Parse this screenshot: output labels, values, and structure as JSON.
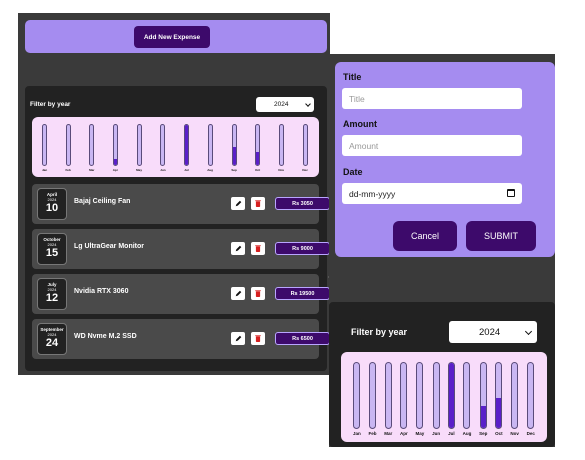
{
  "left_view": {
    "add_button": {
      "label": "Add New Expense"
    },
    "filter": {
      "label": "Filter by year",
      "selected_year": "2024"
    },
    "chart_data": {
      "type": "bar",
      "categories": [
        "Jan",
        "Feb",
        "Mar",
        "Apr",
        "May",
        "Jun",
        "Jul",
        "Aug",
        "Sep",
        "Oct",
        "Nov",
        "Dec"
      ],
      "values": [
        0,
        0,
        0,
        3050,
        0,
        0,
        19500,
        0,
        9000,
        6500,
        0,
        0
      ],
      "ylim": [
        0,
        19500
      ]
    },
    "expenses": [
      {
        "month": "April",
        "year": "2024",
        "day": "10",
        "title": "Bajaj Ceiling Fan",
        "amount": "Rs 3050"
      },
      {
        "month": "October",
        "year": "2024",
        "day": "15",
        "title": "Lg UltraGear Monitor",
        "amount": "Rs 9000"
      },
      {
        "month": "July",
        "year": "2024",
        "day": "12",
        "title": "Nvidia RTX 3060",
        "amount": "Rs 19500"
      },
      {
        "month": "September",
        "year": "2024",
        "day": "24",
        "title": "WD Nvme M.2 SSD",
        "amount": "Rs 6500"
      }
    ]
  },
  "right_view": {
    "form": {
      "title_label": "Title",
      "title_placeholder": "Title",
      "amount_label": "Amount",
      "amount_placeholder": "Amount",
      "date_label": "Date",
      "date_placeholder": "dd-mm-yyyy",
      "cancel_label": "Cancel",
      "submit_label": "SUBMIT"
    },
    "filter": {
      "label": "Filter by year",
      "selected_year": "2024"
    },
    "chart_data": {
      "type": "bar",
      "categories": [
        "Jan",
        "Feb",
        "Mar",
        "Apr",
        "May",
        "Jun",
        "Jul",
        "Aug",
        "Sep",
        "Oct",
        "Nov",
        "Dec"
      ],
      "values": [
        0,
        0,
        0,
        0,
        0,
        0,
        19500,
        0,
        6500,
        9000,
        0,
        0
      ],
      "ylim": [
        0,
        19500
      ]
    }
  },
  "colors": {
    "accent_purple": "#a58cf0",
    "dark_purple": "#3d0a6b",
    "bar_fill": "#5a1fc9",
    "chart_bg": "#f8dcfa"
  }
}
